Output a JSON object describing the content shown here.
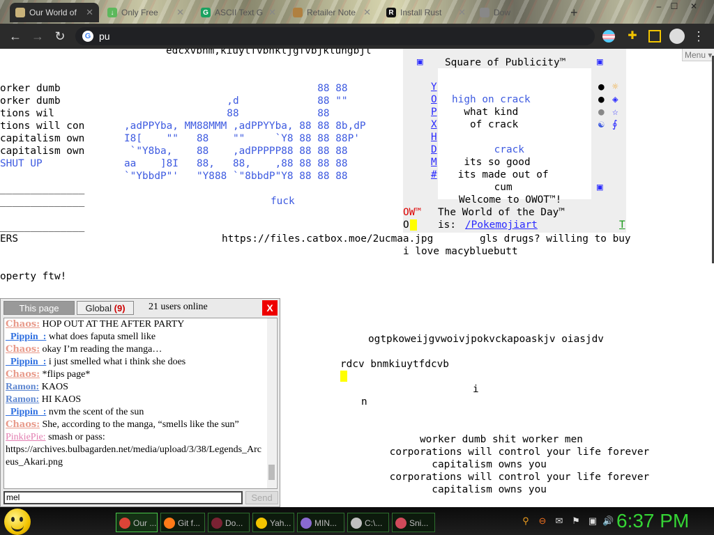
{
  "browser": {
    "tabs": [
      {
        "title": "Our World of",
        "active": true
      },
      {
        "title": "Only Free"
      },
      {
        "title": "ASCII Text G"
      },
      {
        "title": "Retailer Note"
      },
      {
        "title": "Install Rust"
      },
      {
        "title": "Dow"
      }
    ],
    "window_controls": [
      "–",
      "☐",
      "✕"
    ],
    "toolbar": {
      "back": "←",
      "forward": "→",
      "reload": "↻",
      "address": "pu",
      "menu": "⋮"
    }
  },
  "page": {
    "menu_label": "Menu",
    "left_lines": [
      "edcxvbnm,kiuytfvbnkljgfvbjklungbjl",
      "",
      "",
      "orker dumb",
      "orker dumb",
      "tions wil",
      "tions will con",
      "capitalism own",
      "capitalism own",
      "SHUT UP",
      "",
      "______________",
      "______________",
      "",
      "______________",
      "ERS",
      "",
      "",
      "operty ftw!"
    ],
    "figlet_lines": [
      "                                88 88",
      "                 ,d             88 \"\"",
      "                 88             88",
      ",adPPYba, MM88MMM ,adPPYYba, 88 88 8b,dP",
      "I8[    \"\"   88    \"\"     `Y8 88 88 88P'",
      " `\"Y8ba,    88    ,adPPPPP88 88 88 88",
      "aa    ]8I   88,   88,    ,88 88 88 88",
      "`\"YbbdP\"'   \"Y888 `\"8bbdP\"Y8 88 88 88"
    ],
    "fuck_text": "fuck",
    "url_text": "https://files.catbox.moe/2ucmaa.jpg",
    "url_tail": "gls drugs? willing to buy",
    "love_text": "i love macybluebutt",
    "publicity": {
      "corner_tl": "▣",
      "corner_tr": "▣",
      "corner_br": "▣",
      "title": "Square of Publicity™",
      "side_letters": [
        "Y",
        "O",
        "P",
        "X",
        "H",
        "D",
        "M",
        "#"
      ],
      "right_icons": [
        "●",
        "☼",
        "●",
        "◈",
        "●",
        "☆",
        "☯",
        "∮"
      ],
      "lines": [
        "",
        "high on crack",
        "  what kind",
        "   of crack",
        "",
        "",
        "       crack",
        "  its so good",
        " its made out of",
        "       cum"
      ],
      "welcome": "Welcome to OWOT™!",
      "owotd_prefix": "OW™",
      "owotd_label": "The World of the Day™",
      "is_label": "is: ",
      "owotd_link": "/Pokemojiart",
      "o_char": "O",
      "t_char": "T"
    },
    "right_text": {
      "random1": "ogtpkoweijgvwoivjpokvckapoaskjv oiasjdv",
      "random2": "rdcv bnmkiuytfdcvb",
      "i_char": "i",
      "n_char": "n",
      "slogans": [
        "         worker dumb shit worker men",
        "    corporations will control your life forever",
        "           capitalism owns you",
        "    corporations will control your life forever",
        "           capitalism owns you"
      ]
    }
  },
  "chat": {
    "tab_this": "This page",
    "tab_global": "Global",
    "tab_global_count": "(9)",
    "online": "21 users online",
    "close": "X",
    "messages": [
      {
        "nick": "Chaos:",
        "cls": "chaos",
        "text": " HOP OUT AT THE AFTER PARTY"
      },
      {
        "nick": "_Pippin_:",
        "cls": "pip",
        "text": " what does faputa smell like"
      },
      {
        "nick": "Chaos:",
        "cls": "chaos",
        "text": " okay I’m reading the manga…"
      },
      {
        "nick": "_Pippin_:",
        "cls": "pip",
        "text": " i just smelled what i think she does"
      },
      {
        "nick": "Chaos:",
        "cls": "chaos",
        "text": " *flips page*"
      },
      {
        "nick": "Ramon:",
        "cls": "ramon",
        "text": " KAOS"
      },
      {
        "nick": "Ramon:",
        "cls": "ramon",
        "text": " HI KAOS"
      },
      {
        "nick": "_Pippin_:",
        "cls": "pip",
        "text": " nvm the scent of the sun"
      },
      {
        "nick": "Chaos:",
        "cls": "chaos",
        "text": " She, according to the manga, “smells like the sun”"
      },
      {
        "nick": "PinkiePie:",
        "cls": "pinkie",
        "text": " smash or pass: https://archives.bulbagarden.net/media/upload/3/38/Legends_Arceus_Akari.png"
      }
    ],
    "input_value": "mel",
    "send": "Send"
  },
  "taskbar": {
    "tasks": [
      {
        "label": "Our ...",
        "color": "#db4437",
        "active": true
      },
      {
        "label": "Git f...",
        "color": "#ff7a18"
      },
      {
        "label": "Do...",
        "color": "#7a2233"
      },
      {
        "label": "Yah...",
        "color": "#f2c400"
      },
      {
        "label": "MIN...",
        "color": "#8a6ad0"
      },
      {
        "label": "C:\\...",
        "color": "#c0c0c0"
      },
      {
        "label": "Sni...",
        "color": "#d04a5a"
      }
    ],
    "tray": [
      "⚲",
      "⊖",
      "✉",
      "⚑",
      "▣",
      "🔊"
    ],
    "clock": "6:37 PM"
  }
}
